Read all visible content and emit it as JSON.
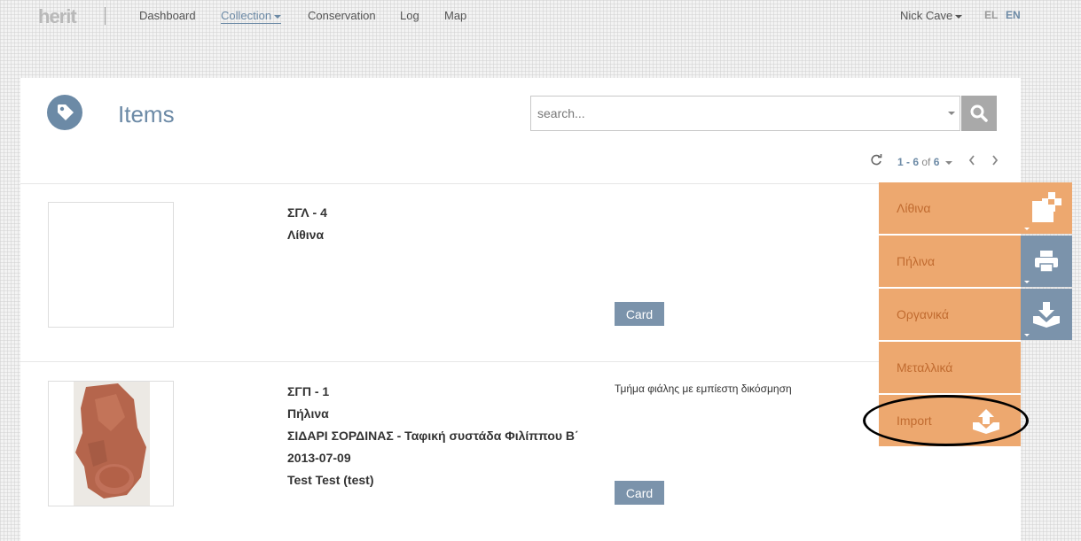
{
  "app": {
    "logo": "herit"
  },
  "nav": {
    "items": [
      {
        "label": "Dashboard"
      },
      {
        "label": "Collection"
      },
      {
        "label": "Conservation"
      },
      {
        "label": "Log"
      },
      {
        "label": "Map"
      }
    ],
    "user": "Nick Cave",
    "languages": [
      "EL",
      "EN"
    ]
  },
  "page": {
    "title": "Items",
    "search": {
      "placeholder": "search..."
    },
    "pagination": {
      "range": "1 - 6",
      "of": "of",
      "total": "6"
    }
  },
  "items": [
    {
      "lines": [
        "ΣΓΛ - 4",
        "Λίθινα"
      ],
      "description": "",
      "card_label": "Card"
    },
    {
      "lines": [
        "ΣΓΠ - 1",
        "Πήλινα",
        "ΣΙΔΑΡΙ ΣΟΡΔΙΝΑΣ - Ταφική συστάδα Φιλίππου Β΄",
        "2013-07-09",
        "Test Test (test)"
      ],
      "description": "Τμήμα φιάλης με εμπίεστη δικόσμηση",
      "card_label": "Card"
    }
  ],
  "action_menu": {
    "items": [
      {
        "label": "Λίθινα"
      },
      {
        "label": "Πήλινα"
      },
      {
        "label": "Οργανικά"
      },
      {
        "label": "Μεταλλικά"
      },
      {
        "label": "Import"
      }
    ]
  },
  "colors": {
    "accent": "#6c8aa6",
    "menu_orange": "#eda86f",
    "menu_text": "#c06b30",
    "card_button": "#7b93ab"
  }
}
